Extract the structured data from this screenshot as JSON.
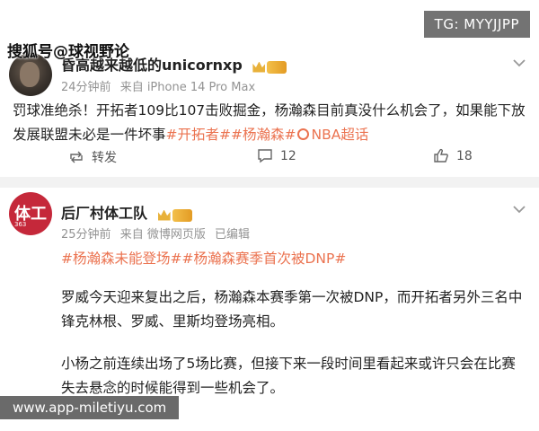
{
  "overlays": {
    "tg_banner": "TG: MYYJJPP",
    "top_watermark": "搜狐号@球视野论",
    "bottom_banner": "www.app-miletiyu.com"
  },
  "post1": {
    "username": "昏高越来越低的unicornxp",
    "time": "24分钟前",
    "source": "来自 iPhone 14 Pro Max",
    "text": "罚球准绝杀！开拓者109比107击败掘金，杨瀚森目前真没什么机会了，如果能下放发展联盟未必是一件坏事",
    "hashtags": [
      "#开拓者#",
      "#杨瀚森#"
    ],
    "topic": "NBA超话",
    "actions": {
      "repost_label": "转发",
      "comment_count": "12",
      "like_count": "18"
    }
  },
  "post2": {
    "username": "后厂村体工队",
    "time": "25分钟前",
    "source": "来自 微博网页版",
    "edited": "已编辑",
    "avatar_text": "体工",
    "avatar_num": "363",
    "tags": "#杨瀚森未能登场##杨瀚森赛季首次被DNP#",
    "paragraph1": "罗威今天迎来复出之后，杨瀚森本赛季第一次被DNP，而开拓者另外三名中锋克林根、罗威、里斯均登场亮相。",
    "paragraph2": "小杨之前连续出场了5场比赛，但接下来一段时间里看起来或许只会在比赛失去悬念的时候能得到一些机会了。"
  },
  "colors": {
    "hashtag": "#eb7350",
    "meta_gray": "#939393",
    "divider": "#f2f2f2"
  }
}
